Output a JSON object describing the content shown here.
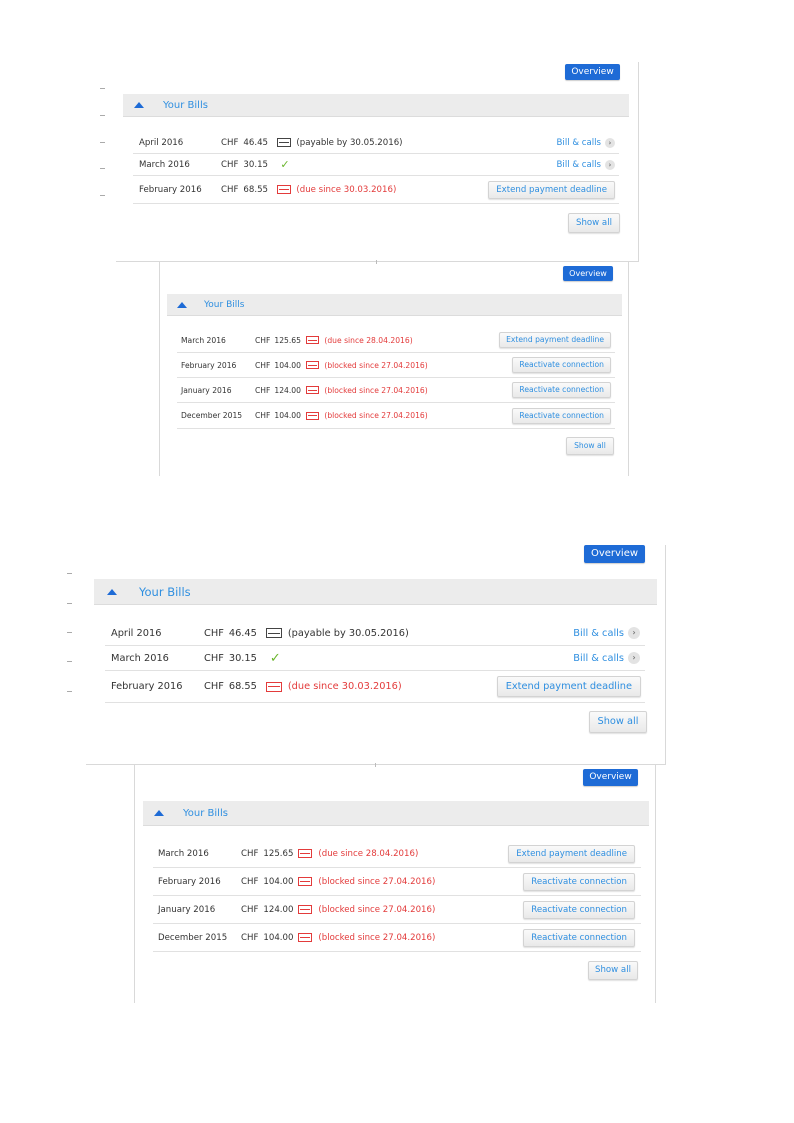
{
  "shot1": {
    "overview": "Overview",
    "header": "Your Bills",
    "bills": [
      {
        "month": "April 2016",
        "currency": "CHF",
        "amount": "46.45",
        "status": "(payable by 30.05.2016)",
        "action": "Bill & calls"
      },
      {
        "month": "March 2016",
        "currency": "CHF",
        "amount": "30.15",
        "status": "",
        "action": "Bill & calls"
      },
      {
        "month": "February 2016",
        "currency": "CHF",
        "amount": "68.55",
        "status": "(due since 30.03.2016)",
        "action": "Extend payment deadline"
      }
    ],
    "show_all": "Show all"
  },
  "shot2": {
    "overview": "Overview",
    "header": "Your Bills",
    "bills": [
      {
        "month": "March 2016",
        "currency": "CHF",
        "amount": "125.65",
        "status": "(due since 28.04.2016)",
        "action": "Extend payment deadline"
      },
      {
        "month": "February 2016",
        "currency": "CHF",
        "amount": "104.00",
        "status": "(blocked since 27.04.2016)",
        "action": "Reactivate connection"
      },
      {
        "month": "January 2016",
        "currency": "CHF",
        "amount": "124.00",
        "status": "(blocked since 27.04.2016)",
        "action": "Reactivate connection"
      },
      {
        "month": "December 2015",
        "currency": "CHF",
        "amount": "104.00",
        "status": "(blocked since 27.04.2016)",
        "action": "Reactivate connection"
      }
    ],
    "show_all": "Show all"
  },
  "colors": {
    "accent": "#1e6bd6",
    "link": "#2f8fe0",
    "alert": "#e33b3b",
    "ok": "#6ab52c"
  },
  "icons": {
    "overdue": "envelope-red-icon",
    "pending": "envelope-icon",
    "paid": "checkmark-icon",
    "more": "chevron-right-icon",
    "collapse": "triangle-up-icon"
  }
}
